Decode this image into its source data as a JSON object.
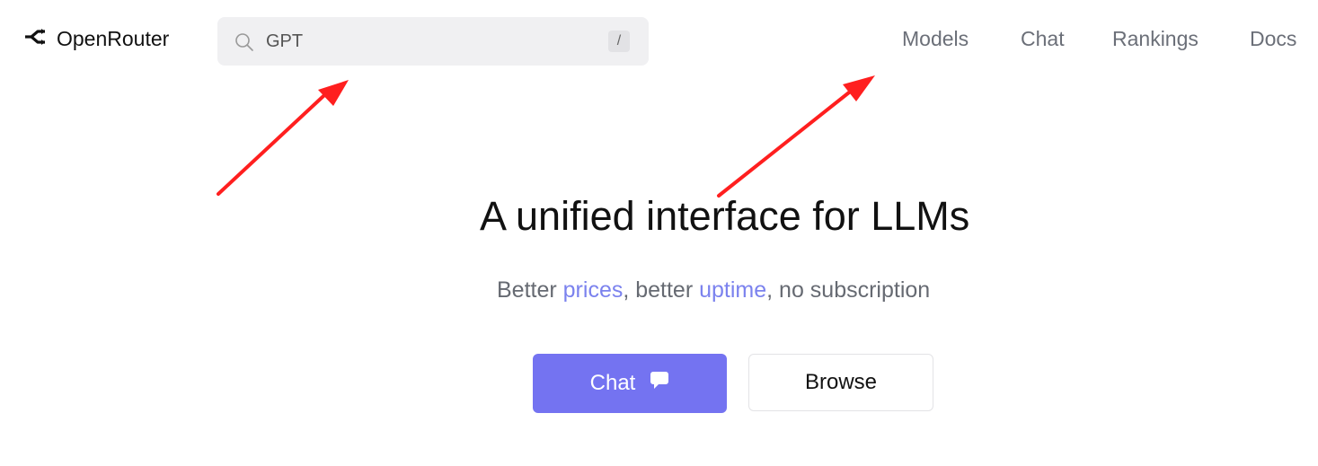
{
  "brand": {
    "name": "OpenRouter",
    "icon": "openrouter-logo-icon"
  },
  "search": {
    "value": "GPT",
    "shortcut": "/",
    "icon": "search-icon"
  },
  "nav": {
    "models": "Models",
    "chat": "Chat",
    "rankings": "Rankings",
    "docs": "Docs"
  },
  "hero": {
    "title": "A unified interface for LLMs",
    "subtitle": {
      "part1": "Better ",
      "link1": "prices",
      "part2": ", better ",
      "link2": "uptime",
      "part3": ", no subscription"
    }
  },
  "actions": {
    "chat_label": "Chat",
    "chat_icon": "chat-bubble-icon",
    "browse_label": "Browse"
  },
  "colors": {
    "accent": "#7473f1",
    "link": "#7b82ee",
    "nav_text": "#6b6f78",
    "annotation_arrow": "#ff1f1f"
  }
}
